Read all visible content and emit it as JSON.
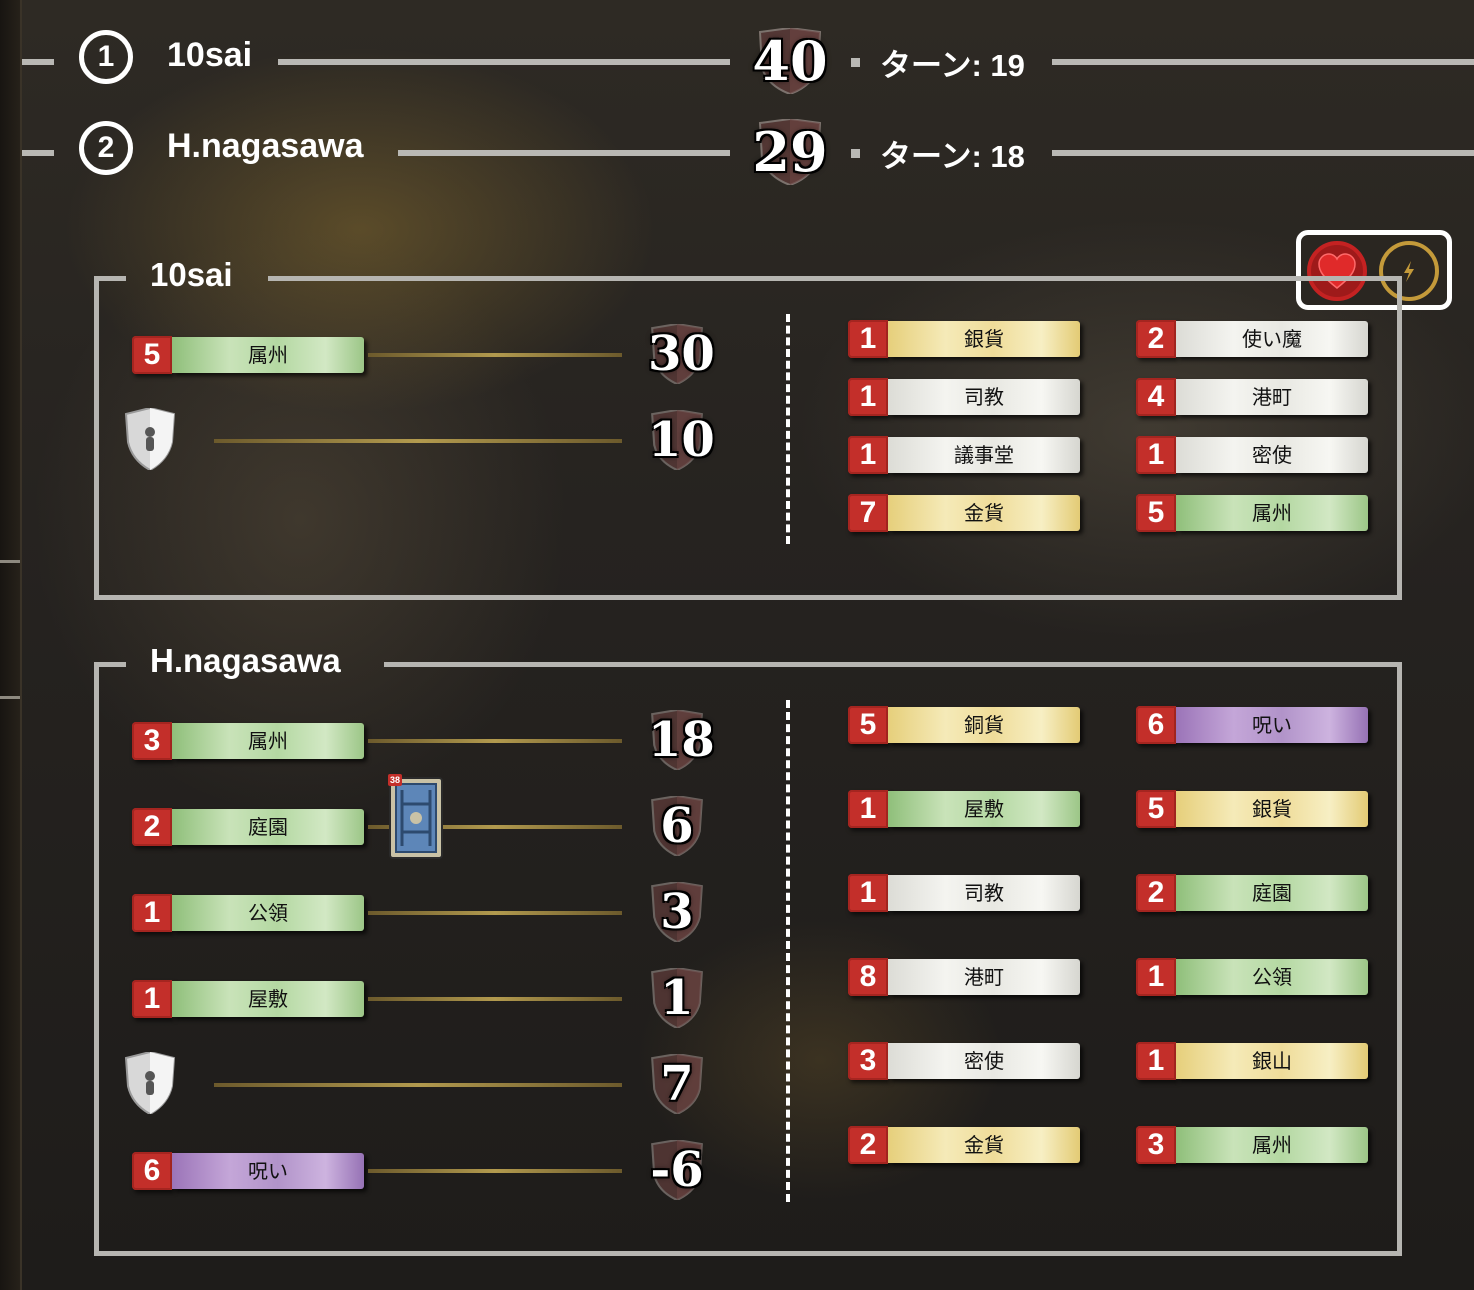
{
  "scoreboard": [
    {
      "rank": "1",
      "name": "10sai",
      "score": "40",
      "turn_label": "ターン: 19"
    },
    {
      "rank": "2",
      "name": "H.nagasawa",
      "score": "29",
      "turn_label": "ターン: 18"
    }
  ],
  "controls": {
    "heart_icon": "heart-icon",
    "lightning_icon": "lightning-icon"
  },
  "panels": [
    {
      "title": "10sai",
      "vp_rows": [
        {
          "count": "5",
          "card": "属州",
          "color": "green",
          "vp": "30"
        },
        {
          "count": "",
          "card": "",
          "color": "",
          "icon": "vp-token-icon",
          "vp": "10"
        }
      ],
      "deck": [
        {
          "count": "1",
          "card": "銀貨",
          "color": "yellow"
        },
        {
          "count": "2",
          "card": "使い魔",
          "color": "white"
        },
        {
          "count": "1",
          "card": "司教",
          "color": "white"
        },
        {
          "count": "4",
          "card": "港町",
          "color": "white"
        },
        {
          "count": "1",
          "card": "議事堂",
          "color": "white"
        },
        {
          "count": "1",
          "card": "密使",
          "color": "white"
        },
        {
          "count": "7",
          "card": "金貨",
          "color": "yellow"
        },
        {
          "count": "5",
          "card": "属州",
          "color": "green"
        }
      ]
    },
    {
      "title": "H.nagasawa",
      "vp_rows": [
        {
          "count": "3",
          "card": "属州",
          "color": "green",
          "vp": "18"
        },
        {
          "count": "2",
          "card": "庭園",
          "color": "green",
          "vp": "6",
          "deck_count": "38"
        },
        {
          "count": "1",
          "card": "公領",
          "color": "green",
          "vp": "3"
        },
        {
          "count": "1",
          "card": "屋敷",
          "color": "green",
          "vp": "1"
        },
        {
          "count": "",
          "card": "",
          "color": "",
          "icon": "vp-token-icon",
          "vp": "7"
        },
        {
          "count": "6",
          "card": "呪い",
          "color": "purple",
          "vp": "-6"
        }
      ],
      "deck": [
        {
          "count": "5",
          "card": "銅貨",
          "color": "yellow"
        },
        {
          "count": "6",
          "card": "呪い",
          "color": "purple"
        },
        {
          "count": "1",
          "card": "屋敷",
          "color": "green"
        },
        {
          "count": "5",
          "card": "銀貨",
          "color": "yellow"
        },
        {
          "count": "1",
          "card": "司教",
          "color": "white"
        },
        {
          "count": "2",
          "card": "庭園",
          "color": "green"
        },
        {
          "count": "8",
          "card": "港町",
          "color": "white"
        },
        {
          "count": "1",
          "card": "公領",
          "color": "green"
        },
        {
          "count": "3",
          "card": "密使",
          "color": "white"
        },
        {
          "count": "1",
          "card": "銀山",
          "color": "yellow"
        },
        {
          "count": "2",
          "card": "金貨",
          "color": "yellow"
        },
        {
          "count": "3",
          "card": "属州",
          "color": "green"
        }
      ]
    }
  ]
}
